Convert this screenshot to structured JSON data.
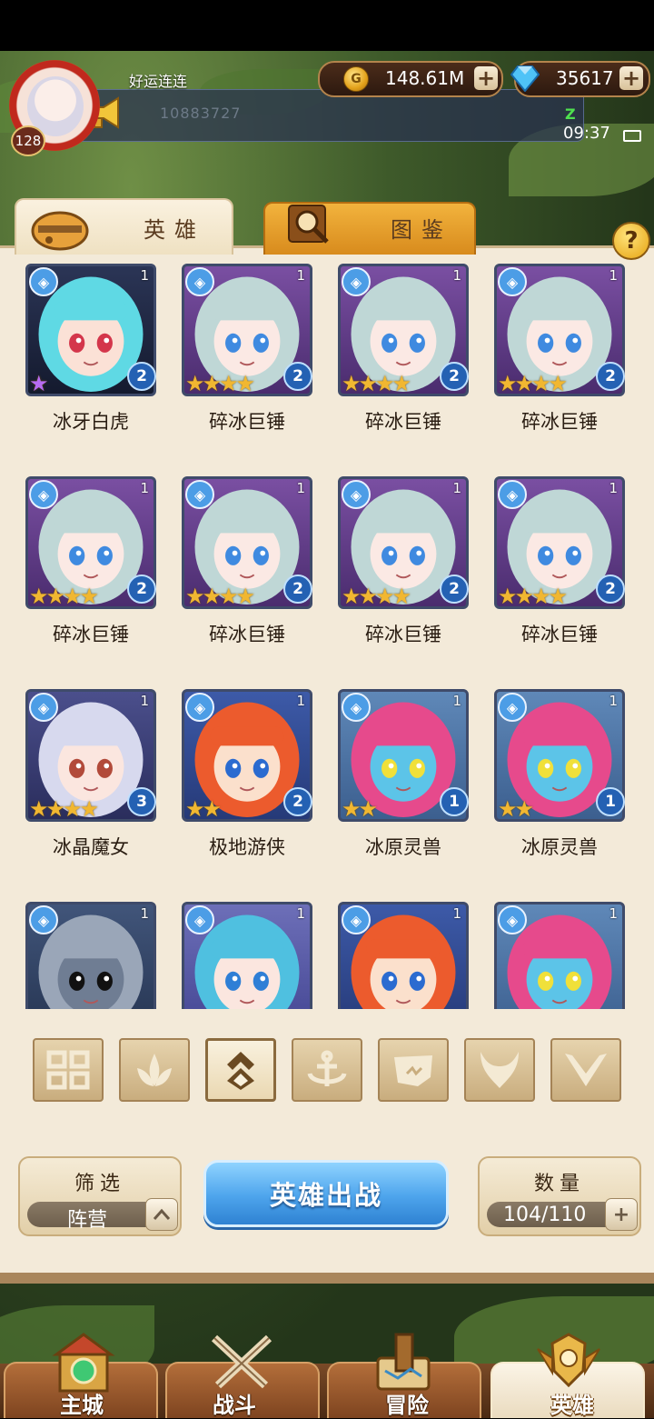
{
  "player": {
    "name": "好运连连",
    "level": "128"
  },
  "notice": {
    "text": "10883727"
  },
  "currency": {
    "gold": "148.61M",
    "gold_icon": "G",
    "gems": "35617",
    "plus": "+"
  },
  "status": {
    "time": "09:37",
    "mark": "Z"
  },
  "tabs": {
    "heroes": "英雄",
    "guide": "图鉴"
  },
  "help": "?",
  "heroes": [
    {
      "name": "冰牙白虎",
      "level": "1",
      "rank": "2",
      "stars": "★",
      "rainbow": true,
      "portrait": "white-tiger"
    },
    {
      "name": "碎冰巨锤",
      "level": "1",
      "rank": "2",
      "stars": "★★★★",
      "portrait": "silver-girl"
    },
    {
      "name": "碎冰巨锤",
      "level": "1",
      "rank": "2",
      "stars": "★★★★",
      "portrait": "silver-girl"
    },
    {
      "name": "碎冰巨锤",
      "level": "1",
      "rank": "2",
      "stars": "★★★★",
      "portrait": "silver-girl"
    },
    {
      "name": "碎冰巨锤",
      "level": "1",
      "rank": "2",
      "stars": "★★★★",
      "portrait": "silver-girl"
    },
    {
      "name": "碎冰巨锤",
      "level": "1",
      "rank": "2",
      "stars": "★★★★",
      "portrait": "silver-girl"
    },
    {
      "name": "碎冰巨锤",
      "level": "1",
      "rank": "2",
      "stars": "★★★★",
      "portrait": "silver-girl"
    },
    {
      "name": "碎冰巨锤",
      "level": "1",
      "rank": "2",
      "stars": "★★★★",
      "portrait": "silver-girl"
    },
    {
      "name": "冰晶魔女",
      "level": "1",
      "rank": "3",
      "stars": "★★★★",
      "portrait": "ice-witch"
    },
    {
      "name": "极地游侠",
      "level": "1",
      "rank": "2",
      "stars": "★★",
      "portrait": "ranger"
    },
    {
      "name": "冰原灵兽",
      "level": "1",
      "rank": "1",
      "stars": "★★",
      "portrait": "blue-beast"
    },
    {
      "name": "冰原灵兽",
      "level": "1",
      "rank": "1",
      "stars": "★★",
      "portrait": "blue-beast"
    },
    {
      "name": "",
      "level": "1",
      "rank": "",
      "stars": "",
      "portrait": "knight"
    },
    {
      "name": "",
      "level": "1",
      "rank": "",
      "stars": "",
      "portrait": "hooded-mage"
    },
    {
      "name": "",
      "level": "1",
      "rank": "",
      "stars": "",
      "portrait": "ranger"
    },
    {
      "name": "",
      "level": "1",
      "rank": "",
      "stars": "",
      "portrait": "blue-beast"
    }
  ],
  "filters": [
    "all-grid-icon",
    "leaf-icon",
    "ice-faction-icon",
    "anchor-icon",
    "beast-icon",
    "horns-icon",
    "wings-icon"
  ],
  "filter_panel": {
    "title": "筛选",
    "value": "阵营"
  },
  "deploy_button": "英雄出战",
  "count_panel": {
    "title": "数量",
    "value": "104/110"
  },
  "nav": [
    {
      "label": "主城",
      "icon": "castle-icon"
    },
    {
      "label": "战斗",
      "icon": "crossed-swords-icon"
    },
    {
      "label": "冒险",
      "icon": "scroll-map-icon"
    },
    {
      "label": "英雄",
      "icon": "hero-emblem-icon",
      "active": true
    }
  ],
  "colors": {
    "panel": "#f3ead9",
    "accent_blue": "#4da4ec",
    "star": "#f1b731",
    "tab_orange": "#e39a28"
  }
}
